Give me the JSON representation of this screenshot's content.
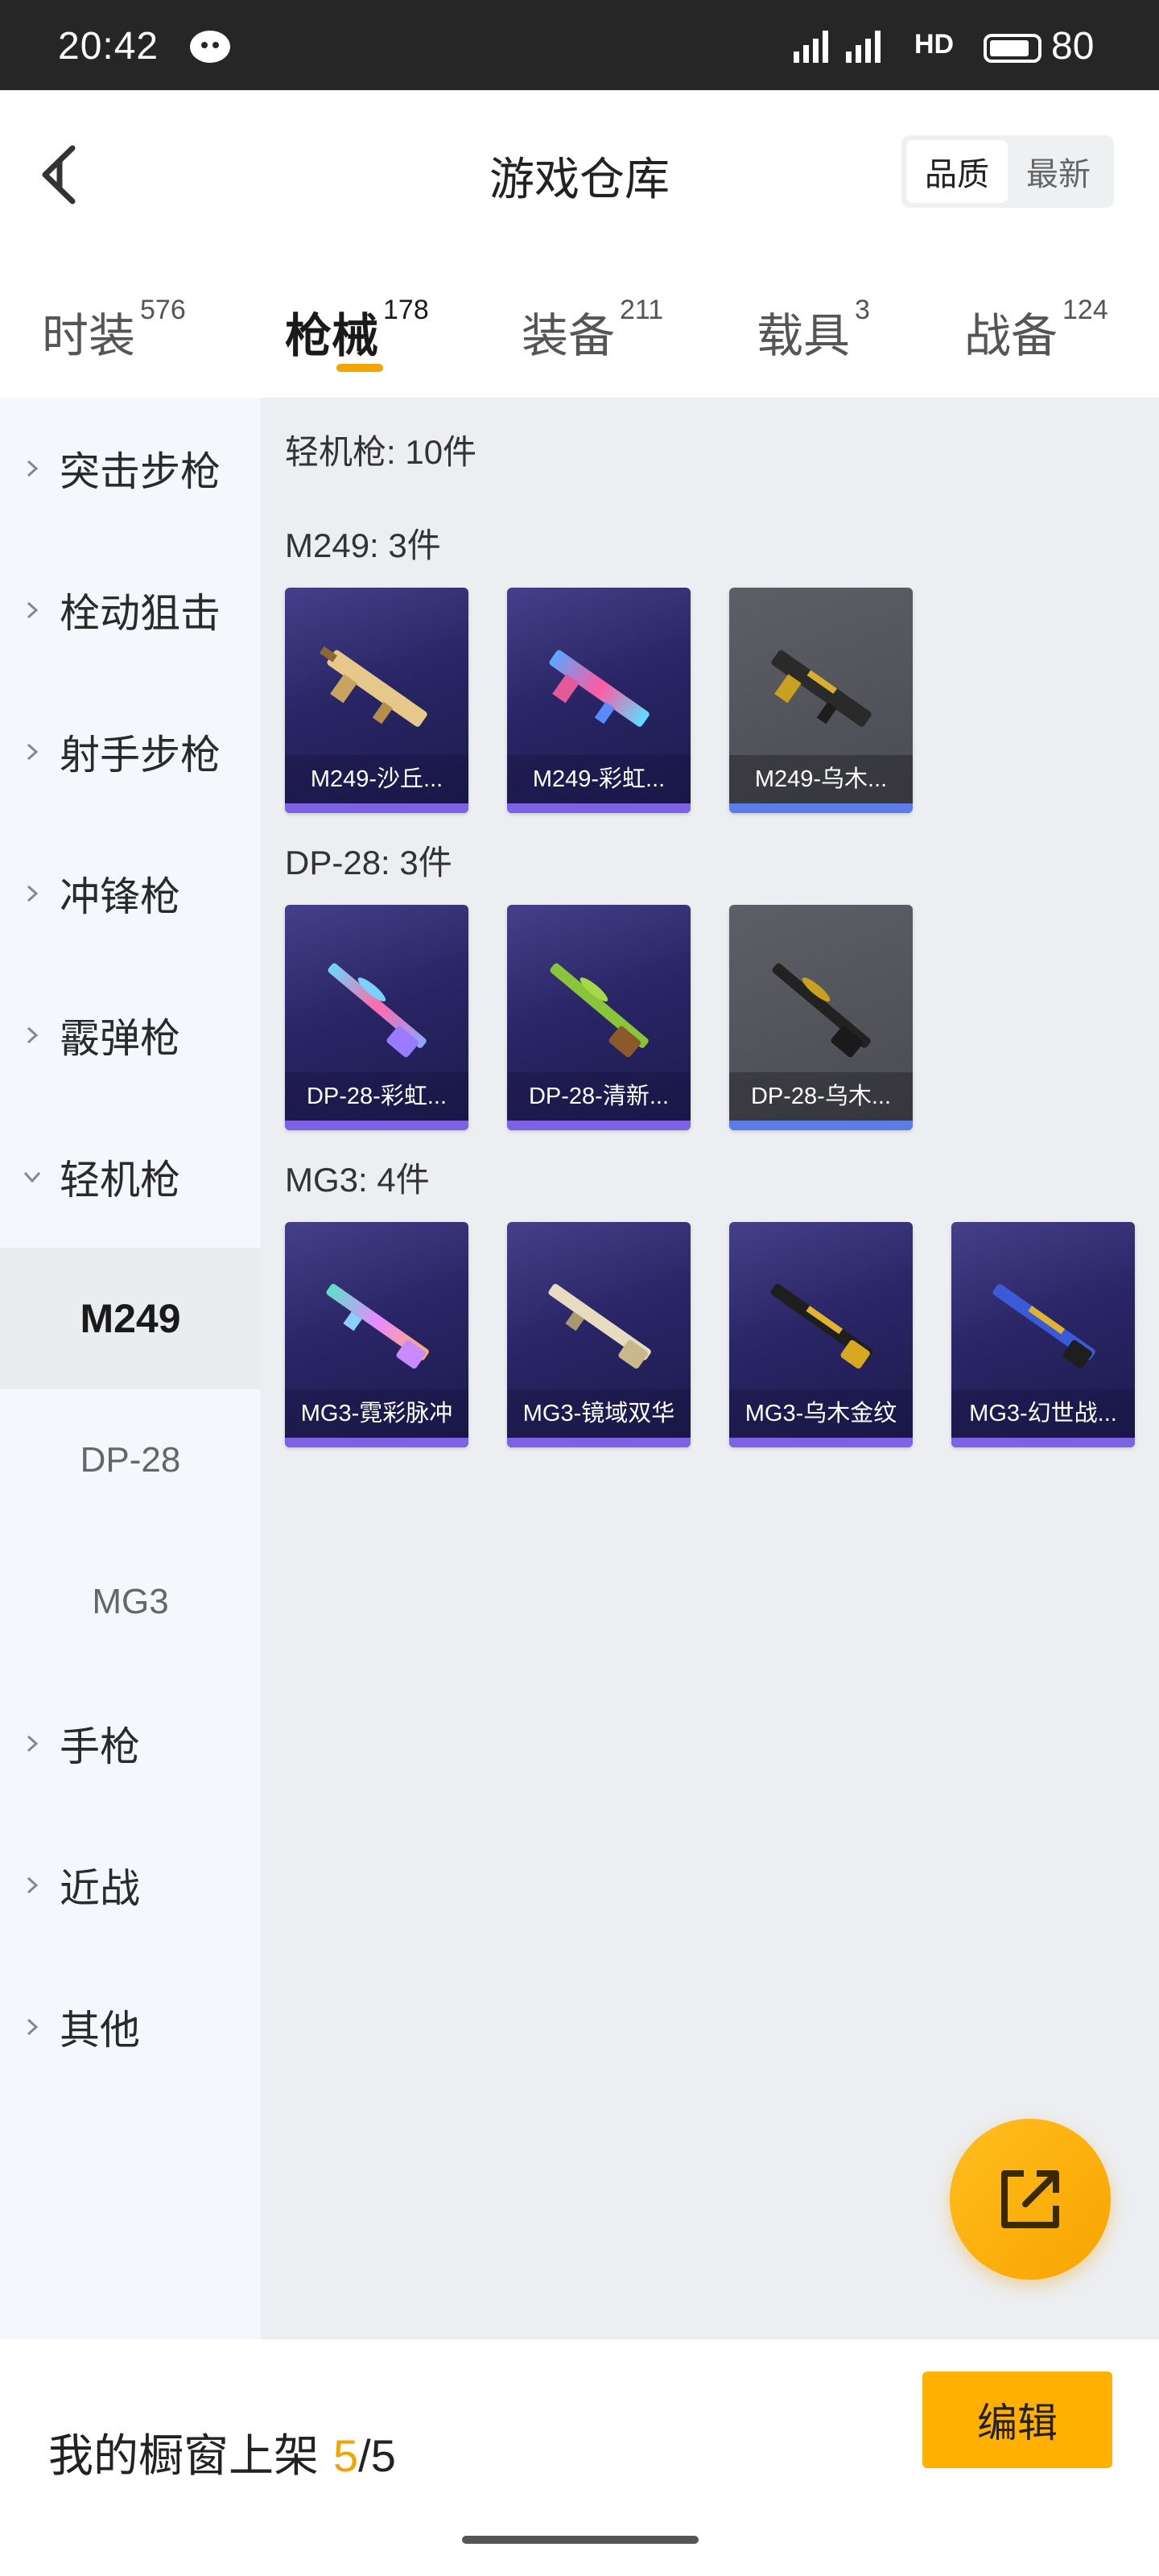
{
  "status_bar": {
    "time": "20:42",
    "network": "HD",
    "battery": "80"
  },
  "header": {
    "title": "游戏仓库",
    "sort": {
      "quality": "品质",
      "newest": "最新"
    }
  },
  "tabs": [
    {
      "label": "时装",
      "count": "576"
    },
    {
      "label": "枪械",
      "count": "178"
    },
    {
      "label": "装备",
      "count": "211"
    },
    {
      "label": "载具",
      "count": "3"
    },
    {
      "label": "战备",
      "count": "124"
    }
  ],
  "sidebar": {
    "categories": [
      "突击步枪",
      "栓动狙击",
      "射手步枪",
      "冲锋枪",
      "霰弹枪",
      "轻机枪",
      "手枪",
      "近战",
      "其他"
    ],
    "subitems": [
      "M249",
      "DP-28",
      "MG3"
    ]
  },
  "content": {
    "summary": "轻机枪: 10件",
    "groups": [
      {
        "title": "M249: 3件",
        "items": [
          "M249-沙丘...",
          "M249-彩虹...",
          "M249-乌木..."
        ]
      },
      {
        "title": "DP-28: 3件",
        "items": [
          "DP-28-彩虹...",
          "DP-28-清新...",
          "DP-28-乌木..."
        ]
      },
      {
        "title": "MG3: 4件",
        "items": [
          "MG3-霓彩脉冲",
          "MG3-镜域双华",
          "MG3-乌木金纹",
          "MG3-幻世战..."
        ]
      }
    ]
  },
  "footer": {
    "showcase_label": "我的橱窗上架",
    "current": "5",
    "total": "/5",
    "edit": "编辑"
  },
  "colors": {
    "accent": "#f5a300",
    "card_purple": "#2a2566",
    "card_gray": "#4a4b52",
    "sidebar_bg": "#f4f7fb",
    "content_bg": "#eceef1"
  }
}
